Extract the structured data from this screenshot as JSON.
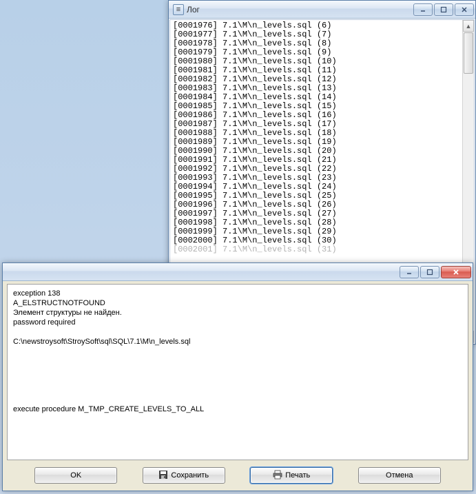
{
  "log_window": {
    "title": "Лог",
    "lines": [
      "[0001976] 7.1\\M\\n_levels.sql (6)",
      "[0001977] 7.1\\M\\n_levels.sql (7)",
      "[0001978] 7.1\\M\\n_levels.sql (8)",
      "[0001979] 7.1\\M\\n_levels.sql (9)",
      "[0001980] 7.1\\M\\n_levels.sql (10)",
      "[0001981] 7.1\\M\\n_levels.sql (11)",
      "[0001982] 7.1\\M\\n_levels.sql (12)",
      "[0001983] 7.1\\M\\n_levels.sql (13)",
      "[0001984] 7.1\\M\\n_levels.sql (14)",
      "[0001985] 7.1\\M\\n_levels.sql (15)",
      "[0001986] 7.1\\M\\n_levels.sql (16)",
      "[0001987] 7.1\\M\\n_levels.sql (17)",
      "[0001988] 7.1\\M\\n_levels.sql (18)",
      "[0001989] 7.1\\M\\n_levels.sql (19)",
      "[0001990] 7.1\\M\\n_levels.sql (20)",
      "[0001991] 7.1\\M\\n_levels.sql (21)",
      "[0001992] 7.1\\M\\n_levels.sql (22)",
      "[0001993] 7.1\\M\\n_levels.sql (23)",
      "[0001994] 7.1\\M\\n_levels.sql (24)",
      "[0001995] 7.1\\M\\n_levels.sql (25)",
      "[0001996] 7.1\\M\\n_levels.sql (26)",
      "[0001997] 7.1\\M\\n_levels.sql (27)",
      "[0001998] 7.1\\M\\n_levels.sql (28)",
      "[0001999] 7.1\\M\\n_levels.sql (29)",
      "[0002000] 7.1\\M\\n_levels.sql (30)"
    ],
    "faded_line": "[0002001] 7.1\\M\\n_levels.sql (31)"
  },
  "error_window": {
    "body": "exception 138\nA_ELSTRUCTNOTFOUND\nЭлемент структуры не найден.\npassword required\n\nC:\\newstroysoft\\StroySoft\\sql\\SQL\\7.1\\M\\n_levels.sql\n\n\n\n\n\n\nexecute procedure M_TMP_CREATE_LEVELS_TO_ALL",
    "buttons": {
      "ok": "OK",
      "save": "Сохранить",
      "print": "Печать",
      "cancel": "Отмена"
    }
  },
  "icons": {
    "app": "≡"
  }
}
